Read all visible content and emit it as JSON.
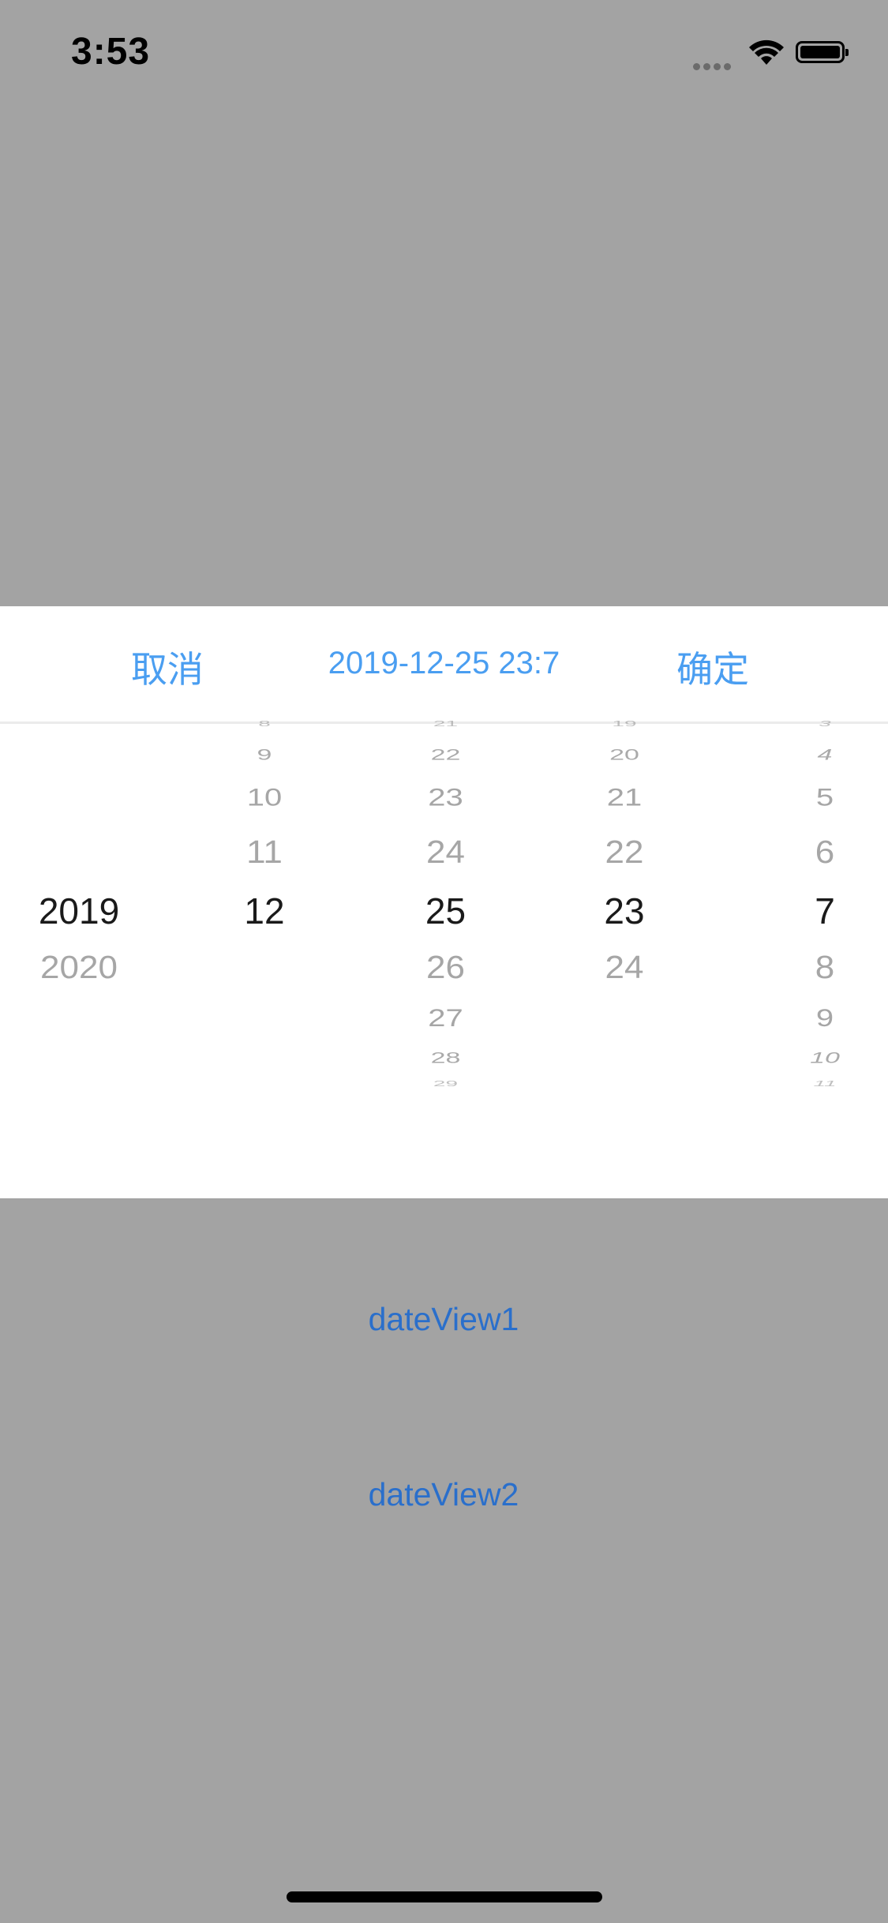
{
  "status_bar": {
    "time": "3:53"
  },
  "toolbar": {
    "cancel_label": "取消",
    "selected_value": "2019-12-25 23:7",
    "confirm_label": "确定",
    "accent_color": "#4a9ef1"
  },
  "picker": {
    "year": {
      "items": [
        "2019",
        "2020"
      ],
      "selected": "2019"
    },
    "month": {
      "items": [
        "8",
        "9",
        "10",
        "11",
        "12"
      ],
      "selected": "12"
    },
    "day": {
      "items": [
        "21",
        "22",
        "23",
        "24",
        "25",
        "26",
        "27",
        "28",
        "29"
      ],
      "selected": "25"
    },
    "hour": {
      "items": [
        "19",
        "20",
        "21",
        "22",
        "23",
        "24"
      ],
      "selected": "23"
    },
    "minute": {
      "items": [
        "3",
        "4",
        "5",
        "6",
        "7",
        "8",
        "9",
        "10",
        "11"
      ],
      "selected": "7"
    }
  },
  "links": {
    "date_view_1": "dateView1",
    "date_view_2": "dateView2"
  }
}
